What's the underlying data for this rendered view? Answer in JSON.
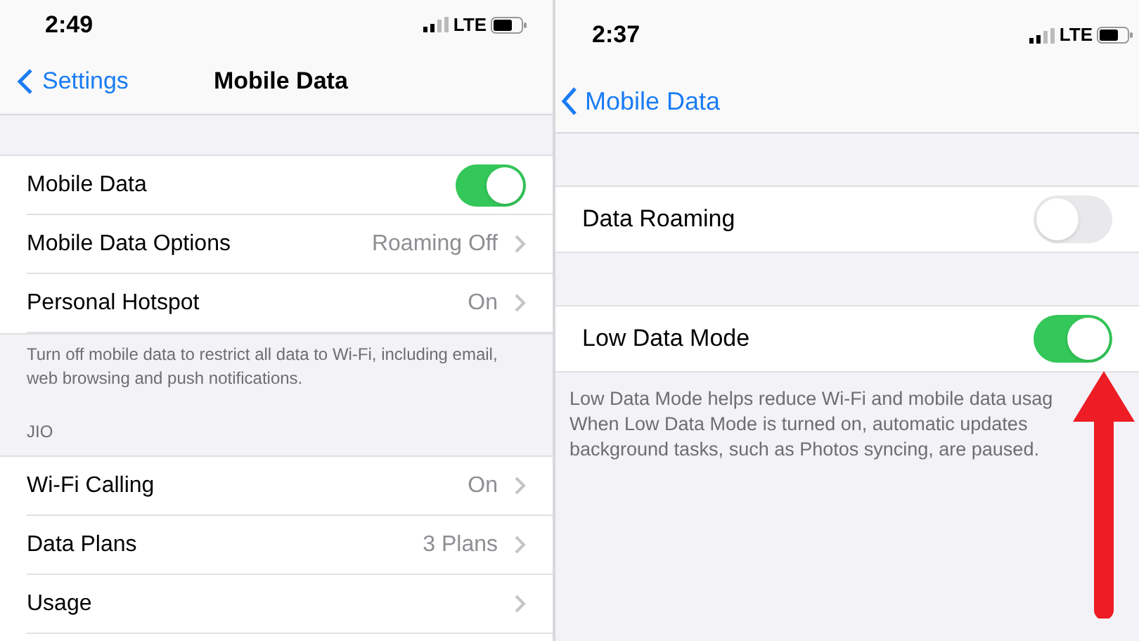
{
  "left_screen": {
    "status_bar": {
      "time": "2:49",
      "network": "LTE"
    },
    "nav": {
      "back": "Settings",
      "title": "Mobile Data"
    },
    "groups": [
      {
        "rows": [
          {
            "kind": "switch",
            "label": "Mobile Data",
            "on": true
          },
          {
            "kind": "link",
            "label": "Mobile Data Options",
            "value": "Roaming Off"
          },
          {
            "kind": "link",
            "label": "Personal Hotspot",
            "value": "On"
          }
        ],
        "footer": "Turn off mobile data to restrict all data to Wi-Fi, including email, web browsing and push notifications."
      },
      {
        "header": "JIO",
        "rows": [
          {
            "kind": "link",
            "label": "Wi-Fi Calling",
            "value": "On"
          },
          {
            "kind": "link",
            "label": "Data Plans",
            "value": "3 Plans"
          },
          {
            "kind": "link",
            "label": "Usage"
          }
        ]
      }
    ]
  },
  "right_screen": {
    "status_bar": {
      "time": "2:37",
      "network": "LTE"
    },
    "nav": {
      "back": "Mobile Data"
    },
    "rows": [
      {
        "kind": "switch",
        "label": "Data Roaming",
        "on": false
      },
      {
        "kind": "switch",
        "label": "Low Data Mode",
        "on": true
      }
    ],
    "footer_lines": [
      "Low Data Mode helps reduce Wi-Fi and mobile data usag",
      "When Low Data Mode is turned on, automatic updates",
      "background tasks, such as Photos syncing, are paused."
    ]
  }
}
